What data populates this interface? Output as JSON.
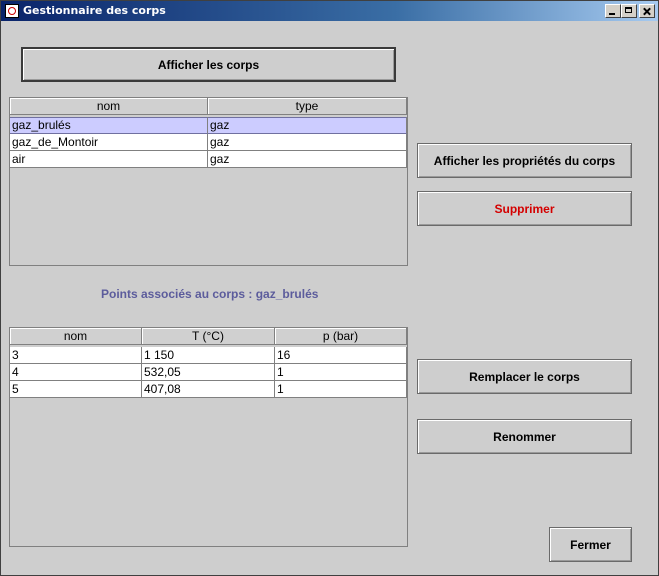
{
  "window": {
    "title": "Gestionnaire des corps",
    "controls": {
      "minimize": "minimize",
      "maximize": "maximize",
      "close": "close"
    }
  },
  "buttons": {
    "show_bodies": "Afficher les corps",
    "show_properties": "Afficher les propriétés du corps",
    "delete": "Supprimer",
    "replace": "Remplacer le corps",
    "rename": "Renommer",
    "close": "Fermer"
  },
  "colors": {
    "delete_text": "#d40000",
    "selection": "#ccccff",
    "points_label": "#5c5c9c"
  },
  "bodies_table": {
    "headers": [
      "nom",
      "type"
    ],
    "rows": [
      {
        "nom": "gaz_brulés",
        "type": "gaz",
        "selected": true
      },
      {
        "nom": "gaz_de_Montoir",
        "type": "gaz",
        "selected": false
      },
      {
        "nom": "air",
        "type": "gaz",
        "selected": false
      }
    ]
  },
  "points_label": "Points associés au corps : gaz_brulés",
  "points_table": {
    "headers": [
      "nom",
      "T (°C)",
      "p (bar)"
    ],
    "rows": [
      {
        "nom": "3",
        "T": "1 150",
        "p": "16"
      },
      {
        "nom": "4",
        "T": "532,05",
        "p": "1"
      },
      {
        "nom": "5",
        "T": "407,08",
        "p": "1"
      }
    ]
  }
}
